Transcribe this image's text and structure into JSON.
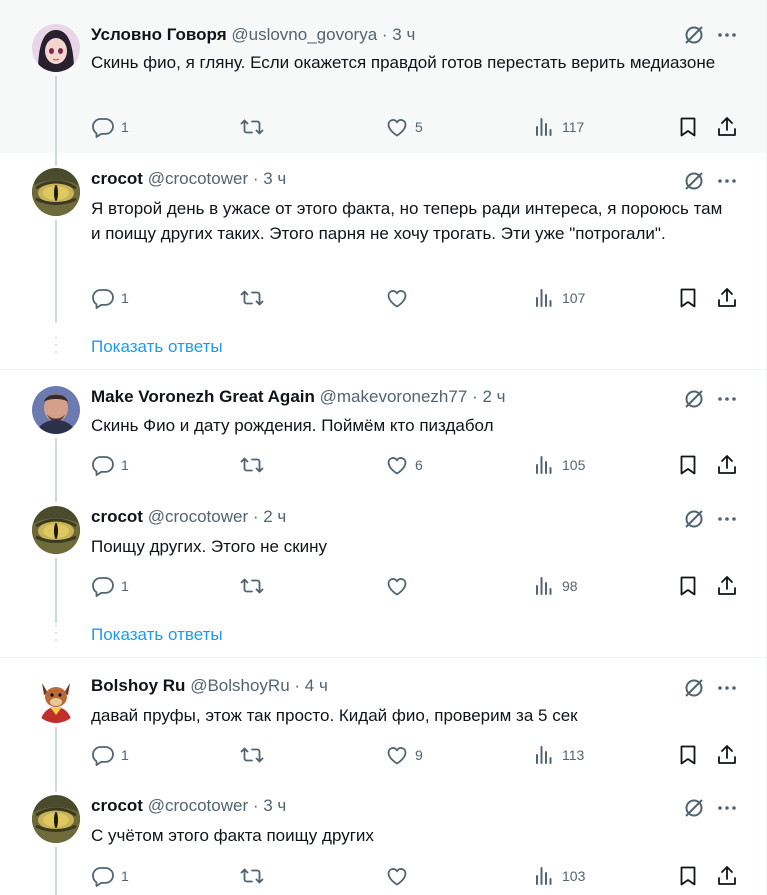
{
  "tweets": [
    {
      "name": "Условно Говоря",
      "handle": "@uslovno_govorya",
      "time": "3 ч",
      "text": "Скинь фио, я гляну. Если окажется правдой готов перестать верить медиазоне",
      "replies": "1",
      "retweets": "",
      "likes": "5",
      "views": "117"
    },
    {
      "name": "crocot",
      "handle": "@crocotower",
      "time": "3 ч",
      "text": "Я второй день в ужасе от этого факта, но теперь ради интереса, я пороюсь там и поищу других таких. Этого парня не хочу трогать. Эти уже \"потрогали\".",
      "replies": "1",
      "retweets": "",
      "likes": "",
      "views": "107"
    },
    {
      "name": "Make Voronezh Great Again",
      "handle": "@makevoronezh77",
      "time": "2 ч",
      "text": "Скинь Фио и дату рождения. Поймём кто пиздабол",
      "replies": "1",
      "retweets": "",
      "likes": "6",
      "views": "105"
    },
    {
      "name": "crocot",
      "handle": "@crocotower",
      "time": "2 ч",
      "text": "Поищу других. Этого не скину",
      "replies": "1",
      "retweets": "",
      "likes": "",
      "views": "98"
    },
    {
      "name": "Bolshoy Ru",
      "handle": "@BolshoyRu",
      "time": "4 ч",
      "text": "давай пруфы, этож так просто. Кидай фио, проверим за 5 сек",
      "replies": "1",
      "retweets": "",
      "likes": "9",
      "views": "113"
    },
    {
      "name": "crocot",
      "handle": "@crocotower",
      "time": "3 ч",
      "text": "С учётом этого факта поищу других",
      "replies": "1",
      "retweets": "",
      "likes": "",
      "views": "103"
    }
  ],
  "separator_dot": "·",
  "show_replies_label": "Показать ответы",
  "icons": [
    "grok-icon",
    "more-icon",
    "reply-icon",
    "retweet-icon",
    "like-icon",
    "views-icon",
    "bookmark-icon",
    "share-icon"
  ],
  "colors": {
    "accent": "#1d9bf0",
    "secondary_text": "#536471",
    "thread_line": "#cfd9de",
    "highlight_bg": "#f7f9f9"
  }
}
